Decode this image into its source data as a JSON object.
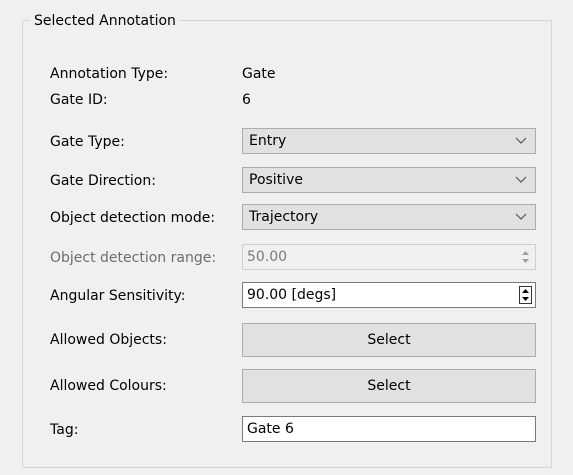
{
  "group_title": "Selected Annotation",
  "annotation_type": {
    "label": "Annotation Type:",
    "value": "Gate"
  },
  "gate_id": {
    "label": "Gate ID:",
    "value": "6"
  },
  "gate_type": {
    "label": "Gate Type:",
    "value": "Entry"
  },
  "gate_direction": {
    "label": "Gate Direction:",
    "value": "Positive"
  },
  "detection_mode": {
    "label": "Object detection mode:",
    "value": "Trajectory"
  },
  "detection_range": {
    "label": "Object detection range:",
    "value": "50.00"
  },
  "angular_sensitivity": {
    "label": "Angular Sensitivity:",
    "value": "90.00 [degs]"
  },
  "allowed_objects": {
    "label": "Allowed Objects:",
    "button": "Select"
  },
  "allowed_colours": {
    "label": "Allowed Colours:",
    "button": "Select"
  },
  "tag": {
    "label": "Tag:",
    "value": "Gate 6"
  },
  "icons": {
    "dropdown": "chevron-down-icon",
    "spinner": "spin-arrows-icon"
  },
  "colors": {
    "background": "#f0f0f0",
    "combo_background": "#e1e1e1",
    "disabled_text": "#7a7a7a"
  }
}
